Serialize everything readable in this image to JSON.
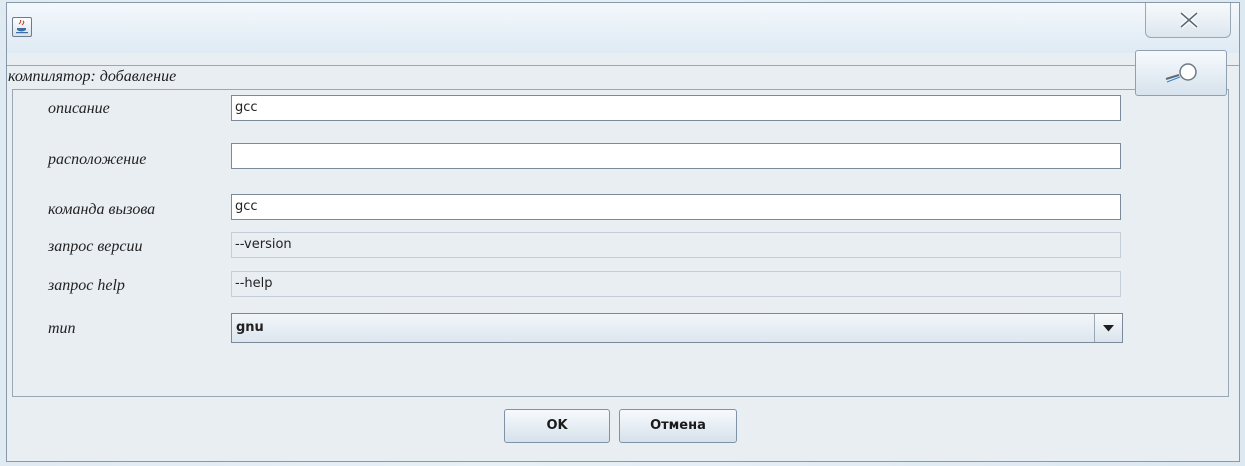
{
  "window": {
    "title": "",
    "section_title": "компилятор: добавление"
  },
  "form": {
    "description": {
      "label": "описание",
      "value": "gcc"
    },
    "location": {
      "label": "расположение",
      "value": ""
    },
    "command": {
      "label": "команда вызова",
      "value": "gcc"
    },
    "version_query": {
      "label": "запрос версии",
      "value": "--version"
    },
    "help_query": {
      "label": "запрос help",
      "value": "--help"
    },
    "type": {
      "label": "тип",
      "value": "gnu"
    }
  },
  "buttons": {
    "ok": "OK",
    "cancel": "Отмена"
  },
  "icons": {
    "app": "java-icon",
    "close": "close-icon",
    "browse": "browse-icon",
    "dropdown": "chevron-down-icon"
  }
}
